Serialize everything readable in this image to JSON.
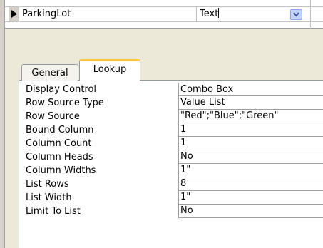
{
  "field_row": {
    "field_name": "ParkingLot",
    "data_type": "Text"
  },
  "tabs": [
    {
      "label": "General",
      "selected": false
    },
    {
      "label": "Lookup",
      "selected": true
    }
  ],
  "properties": [
    {
      "label": "Display Control",
      "value": "Combo Box"
    },
    {
      "label": "Row Source Type",
      "value": "Value List"
    },
    {
      "label": "Row Source",
      "value": "\"Red\";\"Blue\";\"Green\""
    },
    {
      "label": "Bound Column",
      "value": "1"
    },
    {
      "label": "Column Count",
      "value": "1"
    },
    {
      "label": "Column Heads",
      "value": "No"
    },
    {
      "label": "Column Widths",
      "value": "1\""
    },
    {
      "label": "List Rows",
      "value": "8"
    },
    {
      "label": "List Width",
      "value": "1\""
    },
    {
      "label": "Limit To List",
      "value": "No"
    }
  ],
  "icons": {
    "row_selector": "current-row-arrow-icon",
    "data_type_dropdown": "chevron-down-icon"
  },
  "colors": {
    "tab_highlight": "#ffc83c",
    "dialog_background": "#ece9d8"
  }
}
